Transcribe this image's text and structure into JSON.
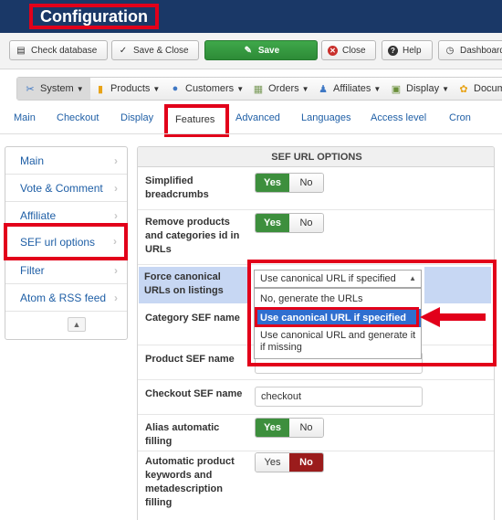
{
  "header": {
    "title": "Configuration"
  },
  "toolbar": {
    "check_database": "Check database",
    "save_close": "Save & Close",
    "save": "Save",
    "close": "Close",
    "help": "Help",
    "dashboard": "Dashboard"
  },
  "menu": {
    "items": [
      {
        "label": "System",
        "icon": "wrench-icon"
      },
      {
        "label": "Products",
        "icon": "products-icon"
      },
      {
        "label": "Customers",
        "icon": "customers-icon"
      },
      {
        "label": "Orders",
        "icon": "orders-icon"
      },
      {
        "label": "Affiliates",
        "icon": "affiliates-icon"
      },
      {
        "label": "Display",
        "icon": "display-icon"
      },
      {
        "label": "Docum",
        "icon": "documentation-icon"
      }
    ]
  },
  "tabs": [
    "Main",
    "Checkout",
    "Display",
    "Features",
    "Advanced",
    "Languages",
    "Access level",
    "Cron"
  ],
  "sidebar": {
    "items": [
      "Main",
      "Vote & Comment",
      "Affiliate",
      "SEF url options",
      "Filter",
      "Atom & RSS feed"
    ]
  },
  "panel": {
    "title": "SEF URL OPTIONS",
    "simplified_breadcrumbs": {
      "label": "Simplified breadcrumbs",
      "yes": "Yes",
      "no": "No"
    },
    "remove_ids": {
      "label": "Remove products and categories id in URLs",
      "yes": "Yes",
      "no": "No"
    },
    "force_canonical": {
      "label": "Force canonical URLs on listings",
      "selected": "Use canonical URL if specified",
      "options": [
        "No, generate the URLs",
        "Use canonical URL if specified",
        "Use canonical URL and generate it if missing"
      ]
    },
    "category_sef": {
      "label": "Category SEF name"
    },
    "product_sef": {
      "label": "Product SEF name"
    },
    "checkout_sef": {
      "label": "Checkout SEF name",
      "value": "checkout"
    },
    "alias_filling": {
      "label": "Alias automatic filling",
      "yes": "Yes",
      "no": "No"
    },
    "auto_keywords": {
      "label": "Automatic product keywords and metadescription filling",
      "yes": "Yes",
      "no": "No"
    }
  },
  "colors": {
    "header_bg": "#1a3867",
    "highlight_red": "#e2001a",
    "save_green": "#2d8b37",
    "link_blue": "#1f5fa6",
    "selected_blue": "#2f6fd0",
    "no_active": "#9b1c1c"
  }
}
